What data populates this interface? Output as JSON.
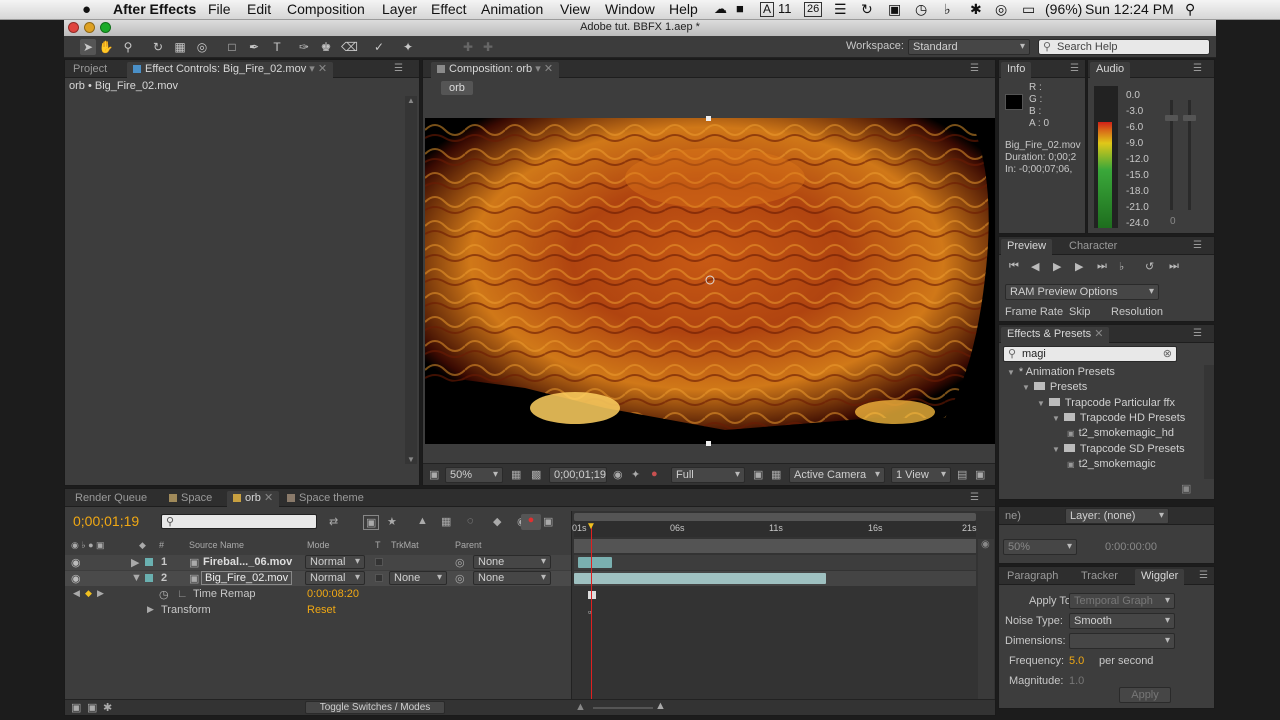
{
  "menubar": {
    "apple": "",
    "app": "After Effects",
    "items": [
      "File",
      "Edit",
      "Composition",
      "Layer",
      "Effect",
      "Animation",
      "View",
      "Window",
      "Help"
    ],
    "battery": "(96%)",
    "clock": "Sun 12:24 PM",
    "badge1": "11",
    "badge2": "26"
  },
  "window": {
    "title": "Adobe tut. BBFX 1.aep *"
  },
  "toolbar": {
    "workspace_label": "Workspace:",
    "workspace_value": "Standard",
    "search_placeholder": "Search Help"
  },
  "left_panel": {
    "tab_project": "Project",
    "tab_effect_controls": "Effect Controls: Big_Fire_02.mov",
    "breadcrumb": "orb • Big_Fire_02.mov"
  },
  "comp_panel": {
    "tab": "Composition: orb",
    "sub_tab": "orb",
    "zoom": "50%",
    "timecode": "0;00;01;19",
    "resolution": "Full",
    "camera": "Active Camera",
    "views": "1 View"
  },
  "info": {
    "tab": "Info",
    "r": "R :",
    "g": "G :",
    "b": "B :",
    "a": "A : 0",
    "file": "Big_Fire_02.mov",
    "duration": "Duration: 0;00;2",
    "in": "In: -0;00;07;06,"
  },
  "audio": {
    "tab": "Audio",
    "levels": [
      "0.0",
      "-3.0",
      "-6.0",
      "-9.0",
      "-12.0",
      "-15.0",
      "-18.0",
      "-21.0",
      "-24.0"
    ],
    "zero": "0",
    "level_fill": 0.75
  },
  "preview": {
    "tab": "Preview",
    "tab2": "Character",
    "ram_options": "RAM Preview Options",
    "frame_rate": "Frame Rate",
    "skip": "Skip",
    "resolution": "Resolution"
  },
  "effects_presets": {
    "tab": "Effects & Presets",
    "search_value": "magi",
    "tree": [
      {
        "label": "* Animation Presets",
        "level": 0
      },
      {
        "label": "Presets",
        "level": 1
      },
      {
        "label": "Trapcode Particular ffx",
        "level": 2
      },
      {
        "label": "Trapcode HD Presets",
        "level": 3
      },
      {
        "label": "t2_smokemagic_hd",
        "level": 4
      },
      {
        "label": "Trapcode SD Presets",
        "level": 3
      },
      {
        "label": "t2_smokemagic",
        "level": 4
      }
    ]
  },
  "layer_panel": {
    "title": "Layer: (none)",
    "zoom": "50%",
    "timecode": "0:00:00:00",
    "partial": "ne)"
  },
  "wiggler": {
    "tabs": [
      "Paragraph",
      "Tracker",
      "Wiggler"
    ],
    "apply_to_label": "Apply To:",
    "apply_to_value": "Temporal Graph",
    "noise_type_label": "Noise Type:",
    "noise_type_value": "Smooth",
    "dimensions_label": "Dimensions:",
    "frequency_label": "Frequency:",
    "frequency_value": "5.0",
    "frequency_unit": "per second",
    "magnitude_label": "Magnitude:",
    "magnitude_value": "1.0",
    "apply_button": "Apply"
  },
  "timeline": {
    "tabs": [
      "Render Queue",
      "Space",
      "orb",
      "Space theme"
    ],
    "tab_colors": [
      "#a08a5a",
      "#a08a5a",
      "#c8a040",
      "#8a7a6a"
    ],
    "timecode": "0;00;01;19",
    "columns": {
      "num": "#",
      "source": "Source Name",
      "mode": "Mode",
      "t": "T",
      "trkmat": "TrkMat",
      "parent": "Parent"
    },
    "ruler": [
      "01s",
      "06s",
      "11s",
      "16s",
      "21s"
    ],
    "layers": [
      {
        "num": "1",
        "name": "Firebal..._06.mov",
        "mode": "Normal",
        "trkmat": "",
        "parent": "None"
      },
      {
        "num": "2",
        "name": "Big_Fire_02.mov",
        "mode": "Normal",
        "trkmat": "None",
        "parent": "None"
      }
    ],
    "time_remap_label": "Time Remap",
    "time_remap_value": "0:00:08:20",
    "transform_label": "Transform",
    "transform_reset": "Reset",
    "toggle_label": "Toggle Switches / Modes"
  }
}
